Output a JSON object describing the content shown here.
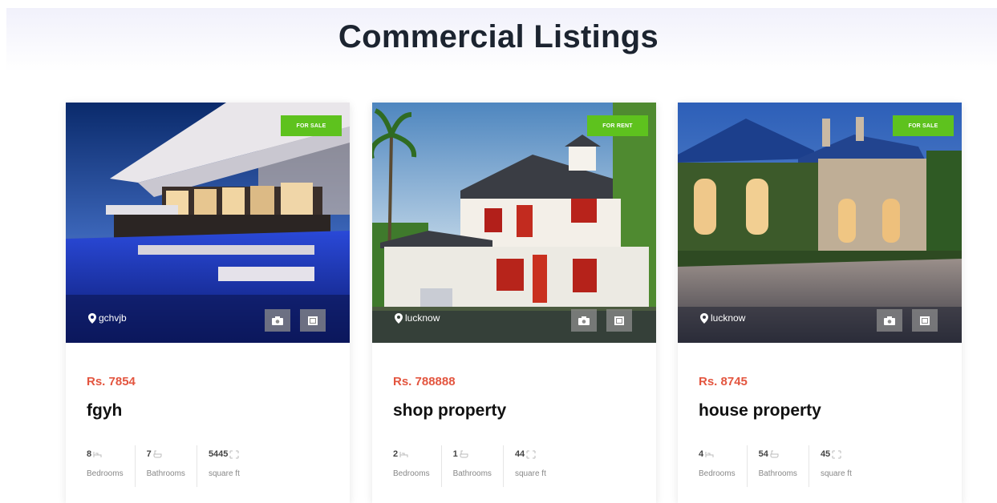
{
  "page": {
    "title": "Commercial Listings"
  },
  "listings": [
    {
      "badge": "For Sale",
      "location": "gchvjb",
      "price": "Rs. 7854",
      "name": "fgyh",
      "bedrooms": "8",
      "bathrooms": "7",
      "area": "5445",
      "bedrooms_label": "Bedrooms",
      "bathrooms_label": "Bathrooms",
      "area_label": "square ft"
    },
    {
      "badge": "For Rent",
      "location": "lucknow",
      "price": "Rs. 788888",
      "name": "shop property",
      "bedrooms": "2",
      "bathrooms": "1",
      "area": "44",
      "bedrooms_label": "Bedrooms",
      "bathrooms_label": "Bathrooms",
      "area_label": "square ft"
    },
    {
      "badge": "For Sale",
      "location": "lucknow",
      "price": "Rs. 8745",
      "name": "house property",
      "bedrooms": "4",
      "bathrooms": "54",
      "area": "45",
      "bedrooms_label": "Bedrooms",
      "bathrooms_label": "Bathrooms",
      "area_label": "square ft"
    }
  ],
  "colors": {
    "badge": "#5ec21e",
    "price": "#e3553f",
    "title": "#1c2430"
  },
  "icons": [
    "map-pin-icon",
    "camera-icon",
    "video-icon",
    "bed-icon",
    "bath-icon",
    "area-icon"
  ]
}
